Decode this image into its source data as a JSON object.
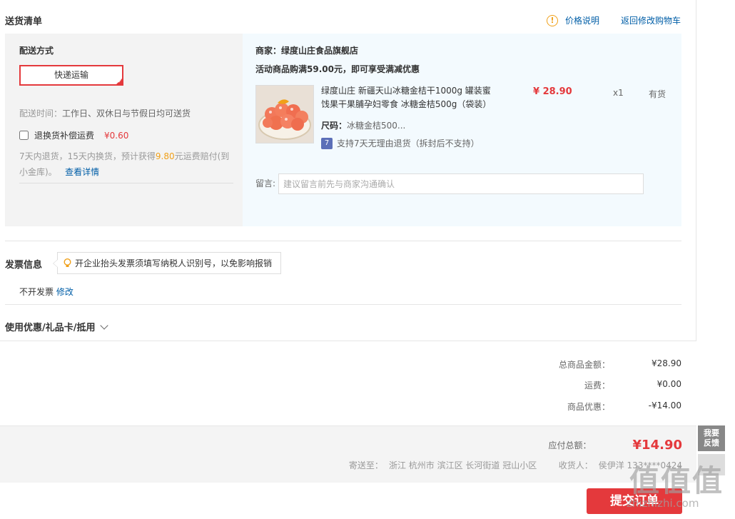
{
  "section": {
    "title": "送货清单",
    "price_explain": "价格说明",
    "back_cart": "返回修改购物车"
  },
  "shipping": {
    "label": "配送方式",
    "method": "快递运输",
    "time_label": "配送时间：",
    "time_value": "工作日、双休日与节假日均可送货",
    "insurance_label": "退换货补偿运费",
    "insurance_price": "¥0.60",
    "insurance_checked": false,
    "desc_prefix": "7天内退货，15天内换货，预计获得",
    "desc_amount": "9.80",
    "desc_suffix": "元运费赔付(到小金库)。",
    "detail_link": "查看详情"
  },
  "order": {
    "merchant_label": "商家：",
    "merchant_name": "绿度山庄食品旗舰店",
    "promo": "活动商品购满59.00元，即可享受满减优惠",
    "product": {
      "name": "绿度山庄 新疆天山冰糖金桔干1000g 罐装蜜饯果干果脯孕妇零食 冰糖金桔500g（袋装）",
      "price": "¥ 28.90",
      "qty": "x1",
      "stock": "有货",
      "size_label": "尺码：",
      "size_value": "冰糖金桔500...",
      "return_icon": "7",
      "return_text": "支持7天无理由退货（拆封后不支持）"
    },
    "message_label": "留言:",
    "message_placeholder": "建议留言前先与商家沟通确认"
  },
  "invoice": {
    "title": "发票信息",
    "tip": "开企业抬头发票须填写纳税人识别号，以免影响报销",
    "value": "不开发票",
    "modify": "修改"
  },
  "coupon": {
    "label": "使用优惠/礼品卡/抵用"
  },
  "summary": [
    {
      "label": "总商品金额：",
      "value": "¥28.90"
    },
    {
      "label": "运费：",
      "value": "¥0.00"
    },
    {
      "label": "商品优惠：",
      "value": "-¥14.00"
    }
  ],
  "total": {
    "label": "应付总额：",
    "amount": "¥14.90",
    "ship_to_label": "寄送至：",
    "address": "浙江 杭州市 滨江区 长河街道 冠山小区",
    "receiver_label": "收货人：",
    "receiver": "侯伊洋 133****0424"
  },
  "submit": {
    "label": "提交订单"
  },
  "feedback": {
    "label": "我要反馈"
  },
  "watermark": {
    "chars": "值值值",
    "url": "zhizhizhi.com"
  },
  "colors": {
    "accent": "#e4393c",
    "link": "#005ea7",
    "warn": "#f0a019",
    "panel": "#f3fafe"
  }
}
